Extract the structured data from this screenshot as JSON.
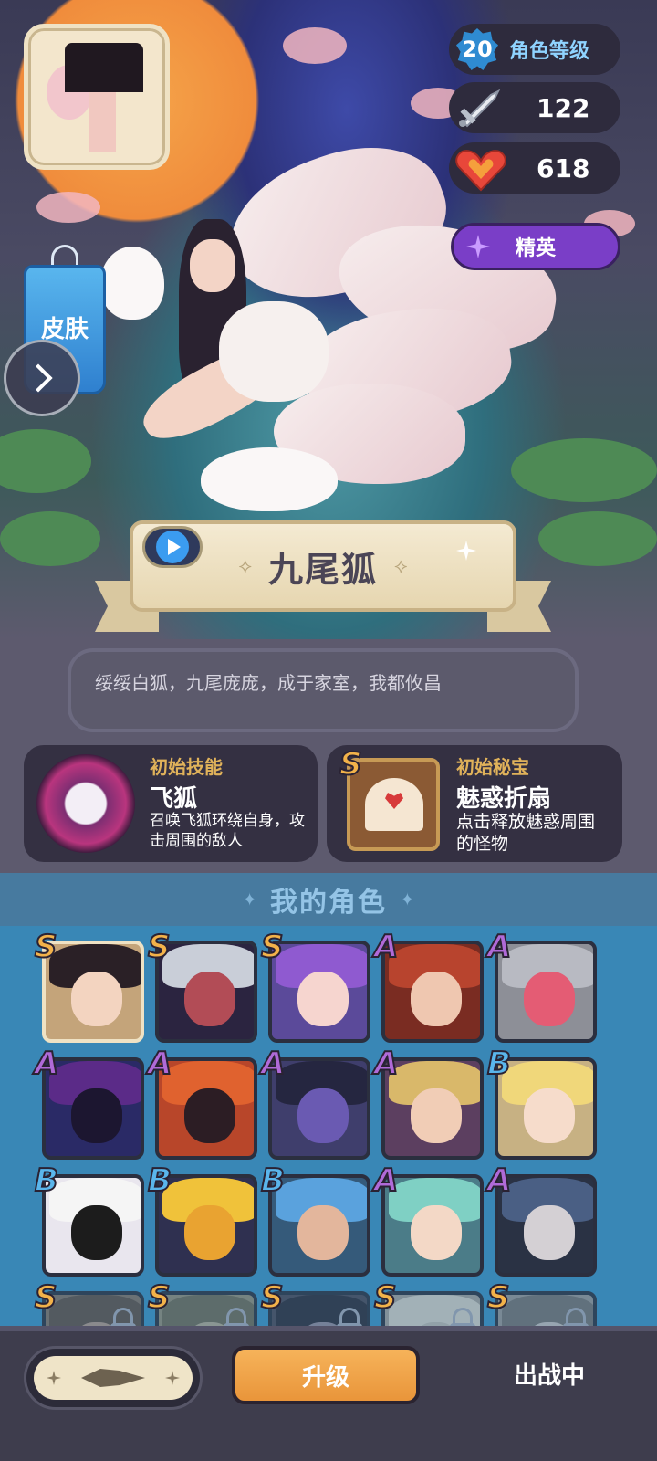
{
  "hero": {
    "level": "20",
    "level_label": "角色等级",
    "attack": "122",
    "hp": "618",
    "rarity_label": "精英",
    "skin_label": "皮肤",
    "name": "九尾狐",
    "name_deco_left": "⟡",
    "name_deco_right": "⟡",
    "quote": "绥绥白狐，九尾庞庞，成于家室，我都攸昌"
  },
  "skill": {
    "kind": "初始技能",
    "title": "飞狐",
    "desc": "召唤飞狐环绕自身，攻击周围的敌人"
  },
  "treasure": {
    "grade": "S",
    "kind": "初始秘宝",
    "title": "魅惑折扇",
    "desc": "点击释放魅惑周围的怪物"
  },
  "roles": {
    "title": "我的角色",
    "deco": "✦",
    "grid": [
      {
        "grade": "S",
        "locked": false,
        "selected": true,
        "palette": {
          "bg": "#c4a47a",
          "hair": "#2a2026",
          "skin": "#f3d4c0"
        }
      },
      {
        "grade": "S",
        "locked": false,
        "selected": false,
        "palette": {
          "bg": "#2b2440",
          "hair": "#c9ced8",
          "skin": "#b24c56"
        }
      },
      {
        "grade": "S",
        "locked": false,
        "selected": false,
        "palette": {
          "bg": "#5b4a9a",
          "hair": "#8f5ad0",
          "skin": "#f6d5cf"
        }
      },
      {
        "grade": "A",
        "locked": false,
        "selected": false,
        "palette": {
          "bg": "#7a2c22",
          "hair": "#b8442e",
          "skin": "#efc7b0"
        }
      },
      {
        "grade": "A",
        "locked": false,
        "selected": false,
        "palette": {
          "bg": "#8d8f97",
          "hair": "#b8bac2",
          "skin": "#e45c74"
        }
      },
      {
        "grade": "A",
        "locked": false,
        "selected": false,
        "palette": {
          "bg": "#2a2a66",
          "hair": "#5b2b88",
          "skin": "#1c1630"
        }
      },
      {
        "grade": "A",
        "locked": false,
        "selected": false,
        "palette": {
          "bg": "#b8462a",
          "hair": "#e0622f",
          "skin": "#2c1d24"
        }
      },
      {
        "grade": "A",
        "locked": false,
        "selected": false,
        "palette": {
          "bg": "#3f3e6c",
          "hair": "#252640",
          "skin": "#6a5ab2"
        }
      },
      {
        "grade": "A",
        "locked": false,
        "selected": false,
        "palette": {
          "bg": "#5c3f60",
          "hair": "#d9b86a",
          "skin": "#f1cdb6"
        }
      },
      {
        "grade": "B",
        "locked": false,
        "selected": false,
        "palette": {
          "bg": "#c7b183",
          "hair": "#f0d77a",
          "skin": "#f6dccb"
        }
      },
      {
        "grade": "B",
        "locked": false,
        "selected": false,
        "palette": {
          "bg": "#e9e6ee",
          "hair": "#f5f5f5",
          "skin": "#1c1c1c"
        }
      },
      {
        "grade": "B",
        "locked": false,
        "selected": false,
        "palette": {
          "bg": "#2f3050",
          "hair": "#f0c23a",
          "skin": "#e9a331"
        }
      },
      {
        "grade": "B",
        "locked": false,
        "selected": false,
        "palette": {
          "bg": "#355a7a",
          "hair": "#5aa2dd",
          "skin": "#e3b69c"
        }
      },
      {
        "grade": "A",
        "locked": false,
        "selected": false,
        "palette": {
          "bg": "#4b7c88",
          "hair": "#7fd0c4",
          "skin": "#f3d8c6"
        }
      },
      {
        "grade": "A",
        "locked": false,
        "selected": false,
        "palette": {
          "bg": "#2a3244",
          "hair": "#4a5f84",
          "skin": "#d4d0d4"
        }
      },
      {
        "grade": "S",
        "locked": true,
        "selected": false,
        "palette": {
          "bg": "#7b6a60",
          "hair": "#5c4b44",
          "skin": "#a58c80"
        }
      },
      {
        "grade": "S",
        "locked": true,
        "selected": false,
        "palette": {
          "bg": "#8a8270",
          "hair": "#6a6352",
          "skin": "#a59c88"
        }
      },
      {
        "grade": "S",
        "locked": true,
        "selected": false,
        "palette": {
          "bg": "#4a4552",
          "hair": "#2e2a36",
          "skin": "#8a8090"
        }
      },
      {
        "grade": "S",
        "locked": true,
        "selected": false,
        "palette": {
          "bg": "#9a9490",
          "hair": "#c5bfb8",
          "skin": "#b0aaa4"
        }
      },
      {
        "grade": "S",
        "locked": true,
        "selected": false,
        "palette": {
          "bg": "#8f8a8a",
          "hair": "#6f6a6a",
          "skin": "#b7b0b0"
        }
      }
    ]
  },
  "bottom": {
    "upgrade_label": "升级",
    "deploy_label": "出战中"
  },
  "colors": {
    "upgrade": "#f0a64a",
    "elite": "#7a3ec7",
    "level_badge": "#2f8bd1",
    "roles_bg": "#3987b6"
  }
}
